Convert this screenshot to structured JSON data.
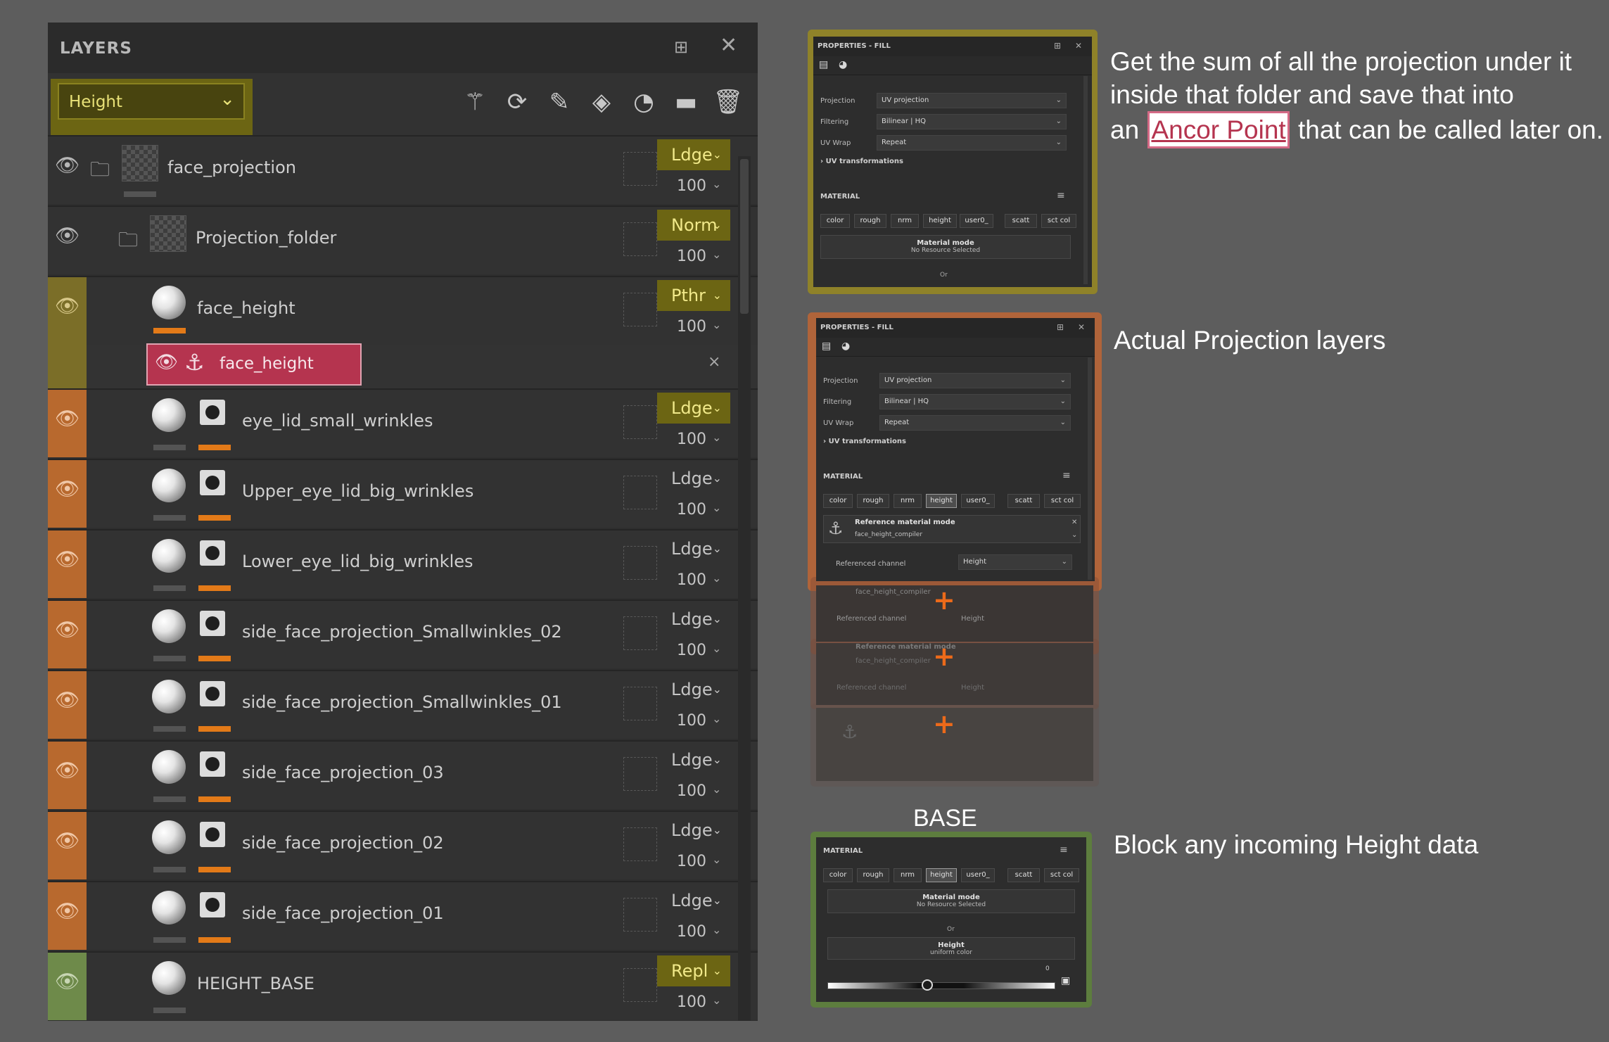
{
  "layers_panel": {
    "title": "LAYERS",
    "channel": "Height",
    "tools": [
      "magic-wand-icon",
      "fill-layer-icon",
      "brush-icon",
      "paint-bucket-icon",
      "smart-material-icon",
      "folder-icon",
      "delete-icon"
    ],
    "rows": [
      {
        "name": "face_projection",
        "blend": "Ldge",
        "opacity": "100"
      },
      {
        "name": "Projection_folder",
        "blend": "Norm",
        "opacity": "100"
      },
      {
        "name": "face_height",
        "blend": "Pthr",
        "opacity": "100"
      },
      {
        "name": "eye_lid_small_wrinkles",
        "blend": "Ldge",
        "opacity": "100"
      },
      {
        "name": "Upper_eye_lid_big_wrinkles",
        "blend": "Ldge",
        "opacity": "100"
      },
      {
        "name": "Lower_eye_lid_big_wrinkles",
        "blend": "Ldge",
        "opacity": "100"
      },
      {
        "name": "side_face_projection_Smallwinkles_02",
        "blend": "Ldge",
        "opacity": "100"
      },
      {
        "name": "side_face_projection_Smallwinkles_01",
        "blend": "Ldge",
        "opacity": "100"
      },
      {
        "name": "side_face_projection_03",
        "blend": "Ldge",
        "opacity": "100"
      },
      {
        "name": "side_face_projection_02",
        "blend": "Ldge",
        "opacity": "100"
      },
      {
        "name": "side_face_projection_01",
        "blend": "Ldge",
        "opacity": "100"
      },
      {
        "name": "HEIGHT_BASE",
        "blend": "Repl",
        "opacity": "100"
      }
    ],
    "anchor": {
      "name": "face_height",
      "close": "×"
    }
  },
  "props_top": {
    "title": "PROPERTIES - FILL",
    "labels": {
      "projection": "Projection",
      "filtering": "Filtering",
      "uvwrap": "UV Wrap"
    },
    "values": {
      "projection": "UV projection",
      "filtering": "Bilinear | HQ",
      "uvwrap": "Repeat"
    },
    "uv_transformations": "UV transformations",
    "material_label": "MATERIAL",
    "chips": [
      "color",
      "rough",
      "nrm",
      "height",
      "user0_",
      "scatt",
      "sct col"
    ],
    "material_mode": "Material mode",
    "no_resource": "No Resource Selected",
    "or": "Or"
  },
  "props_mid": {
    "title": "PROPERTIES - FILL",
    "labels": {
      "projection": "Projection",
      "filtering": "Filtering",
      "uvwrap": "UV Wrap"
    },
    "values": {
      "projection": "UV projection",
      "filtering": "Bilinear | HQ",
      "uvwrap": "Repeat"
    },
    "uv_transformations": "UV transformations",
    "material_label": "MATERIAL",
    "chips": [
      "color",
      "rough",
      "nrm",
      "height",
      "user0_",
      "scatt",
      "sct col"
    ],
    "ref_mode": "Reference material mode",
    "ref_name": "face_height_compiler",
    "ref_channel_label": "Referenced channel",
    "ref_channel_value": "Height",
    "ghost_ref_mode": "Reference material mode"
  },
  "base": {
    "heading": "BASE",
    "material_label": "MATERIAL",
    "chips": [
      "color",
      "rough",
      "nrm",
      "height",
      "user0_",
      "scatt",
      "sct col"
    ],
    "material_mode": "Material mode",
    "no_resource": "No Resource Selected",
    "or": "Or",
    "height_label": "Height",
    "uniform": "uniform color",
    "slider_value": "0"
  },
  "annotations": {
    "top_line1": "Get the sum of all the projection under it",
    "top_line2": "inside that folder and save that into",
    "top_line3_pre": "an",
    "top_line3_hl": "Ancor Point",
    "top_line3_post": "that can be called later on.",
    "mid": "Actual Projection layers",
    "base": "Block any incoming Height data"
  },
  "colors": {
    "yellow_highlight": "#6c6513",
    "orange_stripe": "#b8692e",
    "green_stripe": "#6e8a4a",
    "anchor_red": "#b5344f",
    "frame_yellow": "#8f8229",
    "frame_orange": "#b0643a",
    "frame_green": "#5d7d3e"
  }
}
